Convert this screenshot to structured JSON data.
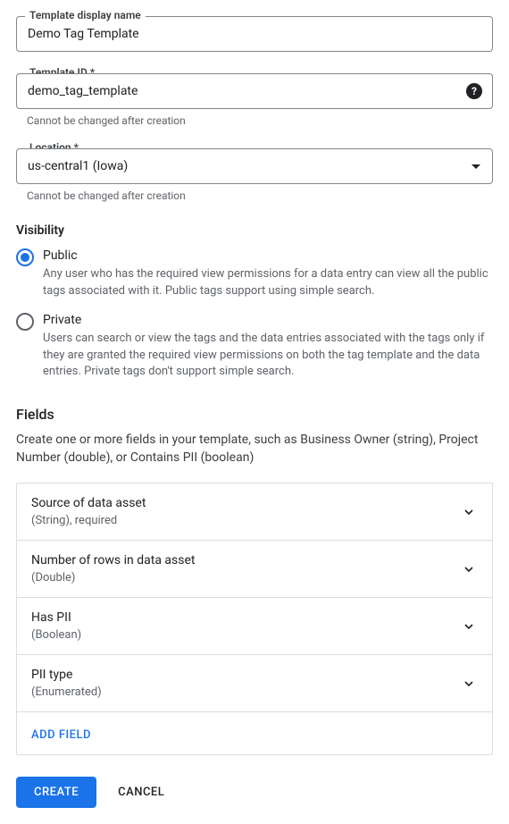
{
  "form": {
    "display_name": {
      "label": "Template display name",
      "value": "Demo Tag Template"
    },
    "template_id": {
      "label": "Template ID *",
      "value": "demo_tag_template",
      "helper": "Cannot be changed after creation"
    },
    "location": {
      "label": "Location *",
      "value": "us-central1 (Iowa)",
      "helper": "Cannot be changed after creation"
    }
  },
  "visibility": {
    "title": "Visibility",
    "options": [
      {
        "label": "Public",
        "description": "Any user who has the required view permissions for a data entry can view all the public tags associated with it. Public tags support using simple search.",
        "selected": true
      },
      {
        "label": "Private",
        "description": "Users can search or view the tags and the data entries associated with the tags only if they are granted the required view permissions on both the tag template and the data entries. Private tags don't support simple search.",
        "selected": false
      }
    ]
  },
  "fields": {
    "title": "Fields",
    "description": "Create one or more fields in your template, such as Business Owner (string), Project Number (double), or Contains PII (boolean)",
    "items": [
      {
        "name": "Source of data asset",
        "type": "(String), required"
      },
      {
        "name": "Number of rows in data asset",
        "type": "(Double)"
      },
      {
        "name": "Has PII",
        "type": "(Boolean)"
      },
      {
        "name": "PII type",
        "type": "(Enumerated)"
      }
    ],
    "add_label": "ADD FIELD"
  },
  "buttons": {
    "create": "CREATE",
    "cancel": "CANCEL"
  }
}
